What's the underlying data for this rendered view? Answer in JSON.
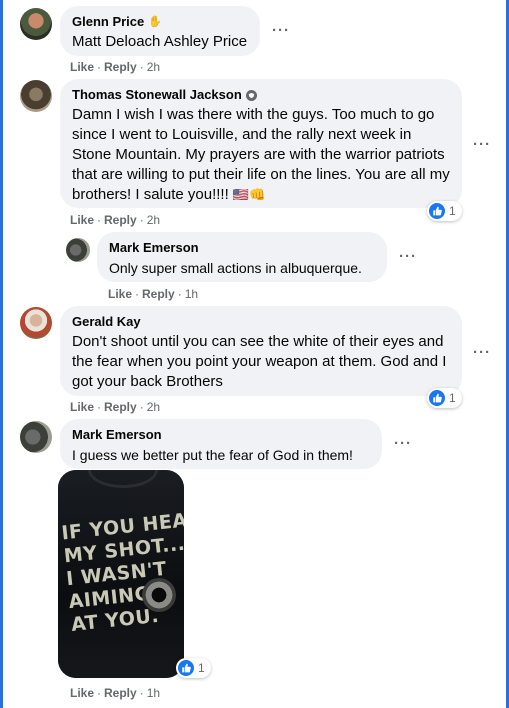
{
  "comments": [
    {
      "author": "Glenn Price",
      "text": "Matt Deloach Ashley Price",
      "like": "Like",
      "reply": "Reply",
      "time": "2h"
    },
    {
      "author": "Thomas Stonewall Jackson",
      "text": "Damn I wish I was there with the guys. Too much to go since I went to Louisville, and the rally next week in Stone Mountain. My prayers are with the warrior patriots that are willing to put their life on the lines. You are all my brothers! I salute you!!!!",
      "emoji": "🇺🇸👊",
      "reactions": "1",
      "like": "Like",
      "reply": "Reply",
      "time": "2h"
    },
    {
      "author": "Mark Emerson",
      "text": "Only super small actions in albuquerque.",
      "like": "Like",
      "reply": "Reply",
      "time": "1h"
    },
    {
      "author": "Gerald Kay",
      "text": "Don't shoot until you can see the white of their eyes and the fear when you point your weapon at them. God and I got your back Brothers",
      "reactions": "1",
      "like": "Like",
      "reply": "Reply",
      "time": "2h"
    },
    {
      "author": "Mark Emerson",
      "text": "I guess we better put the fear of God in them!",
      "photo_text": "IF YOU HEARD\nMY SHOT...\nI WASN'T\nAIMING\nAT YOU.",
      "reactions": "1",
      "like": "Like",
      "reply": "Reply",
      "time": "1h"
    }
  ],
  "colors": {
    "like_blue": "#1877f2",
    "bubble": "#f0f2f5",
    "meta": "#65676b",
    "frame": "#2d6fd9"
  }
}
